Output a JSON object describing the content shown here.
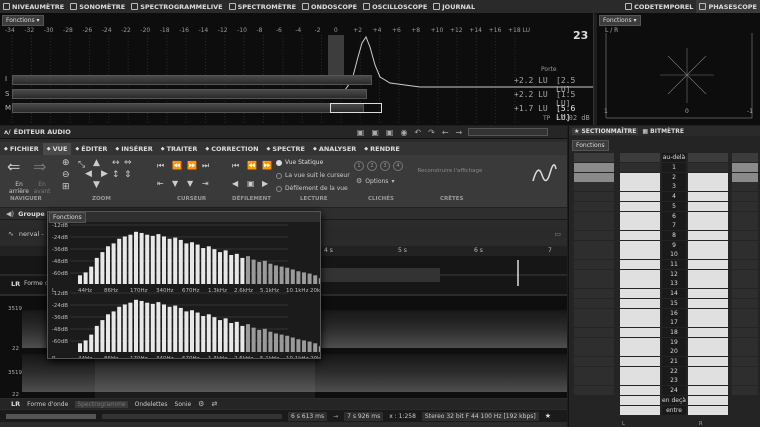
{
  "tabs": [
    {
      "label": "NIVEAUMÈTRE",
      "icon": "bars-icon"
    },
    {
      "label": "SONOMÈTRE",
      "icon": "gauge-icon"
    },
    {
      "label": "SPECTROGRAMMELIVE",
      "icon": "spectrogram-icon"
    },
    {
      "label": "SPECTROMÈTRE",
      "icon": "spectrum-icon"
    },
    {
      "label": "ONDOSCOPE",
      "icon": "wave-icon"
    },
    {
      "label": "OSCILLOSCOPE",
      "icon": "oscilloscope-icon"
    },
    {
      "label": "JOURNAL",
      "icon": "document-icon"
    }
  ],
  "right_tabs": [
    {
      "label": "CODETEMPOREL"
    },
    {
      "label": "PHASESCOPE"
    }
  ],
  "meter": {
    "functions_label": "Fonctions",
    "scale": [
      "-34",
      "-32",
      "-30",
      "-28",
      "-26",
      "-24",
      "-22",
      "-20",
      "-18",
      "-16",
      "-14",
      "-12",
      "-10",
      "-8",
      "-6",
      "-4",
      "-2",
      "0",
      "+2",
      "+4",
      "+6",
      "+8",
      "+10",
      "+12",
      "+14",
      "+16",
      "+18 LU"
    ],
    "rows": [
      {
        "label": "I",
        "value": "+2.2 LU",
        "box": "[2.5 LU]"
      },
      {
        "label": "S",
        "value": "+2.2 LU",
        "box": "[1.5 LU]"
      },
      {
        "label": "M",
        "value": "+1.7 LU",
        "box": "[5.6 LU]"
      }
    ],
    "porte_label": "Porte",
    "tp_label": "TP",
    "tp_value": "-7.02 dB",
    "logo": "23"
  },
  "phasescope": {
    "functions_label": "Fonctions",
    "channels": "L / R",
    "axis_right": "1",
    "axis_center": "0",
    "axis_left": "-1"
  },
  "editor": {
    "title": "ÉDITEUR AUDIO",
    "menus": [
      {
        "label": "FICHIER",
        "icon": "folder-icon"
      },
      {
        "label": "VUE",
        "icon": "eye-icon"
      },
      {
        "label": "ÉDITER",
        "icon": "pencil-icon"
      },
      {
        "label": "INSÉRER",
        "icon": "insert-icon"
      },
      {
        "label": "TRAITER",
        "icon": "process-icon"
      },
      {
        "label": "CORRECTION",
        "icon": "wrench-icon"
      },
      {
        "label": "SPECTRE",
        "icon": "spectre-icon"
      },
      {
        "label": "ANALYSER",
        "icon": "analyze-icon"
      },
      {
        "label": "RENDRE",
        "icon": "render-icon"
      }
    ],
    "groups": [
      "NAVIGUER",
      "ZOOM",
      "CURSEUR",
      "DÉFILEMENT",
      "LECTURE",
      "CLICHÉS",
      "CRÊTES"
    ],
    "nav_back": "En arrière",
    "nav_fwd": "En avant",
    "lecture_options": [
      "Vue Statique",
      "La vue suit le curseur",
      "Défilement de la vue"
    ],
    "options_label": "Options",
    "reconstruct_label": "Reconstruire l'affichage",
    "snapshots": [
      "1",
      "2",
      "3",
      "4"
    ],
    "group_label": "Groupe d",
    "file_label": "nerval -",
    "lr": "LR",
    "waveform_label": "Forme d",
    "view_tabs": [
      "Forme d'onde",
      "Spectrogramme",
      "Ondelettes",
      "Sonie"
    ],
    "timeline": [
      "4 s",
      "5 s",
      "6 s",
      "7"
    ],
    "status": {
      "pos1": "6 s 613 ms",
      "pos2": "7 s 926 ms",
      "zoom": "x : 1:258",
      "format": "Stereo 32 bit F 44 100 Hz [192 kbps]"
    },
    "spec_y": [
      "3519",
      "22",
      "3519",
      "22"
    ]
  },
  "overlay": {
    "title": "Fonctions",
    "db_labels": [
      "-12dB",
      "-24dB",
      "-36dB",
      "-48dB",
      "-60dB"
    ],
    "db_labels2": [
      "-12dB",
      "-24dB",
      "-36dB",
      "-48dB",
      "-60dB"
    ],
    "freqs": [
      "L",
      "44Hz",
      "86Hz",
      "170Hz",
      "340Hz",
      "670Hz",
      "1.3kHz",
      "2.6kHz",
      "5.1kHz",
      "10.1kHz",
      "20kHz"
    ],
    "freqs2": [
      "R",
      "44Hz",
      "86Hz",
      "170Hz",
      "340Hz",
      "670Hz",
      "1.3kHz",
      "2.6kHz",
      "5.1kHz",
      "10.1kHz",
      "20kHz"
    ]
  },
  "section": {
    "tabs": [
      "SECTIONMAÎTRE",
      "BITMÈTRE"
    ],
    "functions_label": "Fonctions",
    "top_label": "au-delà",
    "rows": [
      "1",
      "2",
      "3",
      "4",
      "5",
      "6",
      "7",
      "8",
      "9",
      "10",
      "11",
      "12",
      "13",
      "14",
      "15",
      "16",
      "17",
      "18",
      "19",
      "20",
      "21",
      "22",
      "23",
      "24"
    ],
    "bottom_labels": [
      "en deçà",
      "entre"
    ],
    "l": "L",
    "r": "R"
  }
}
